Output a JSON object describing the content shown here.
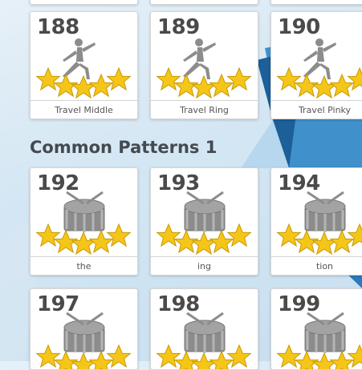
{
  "sections": [
    {
      "title": "",
      "lessons": [
        {
          "number": "188",
          "name": "Travel Middle",
          "icon": "yoga-pose-icon",
          "stars": 5
        },
        {
          "number": "189",
          "name": "Travel Ring",
          "icon": "yoga-pose-icon",
          "stars": 5
        },
        {
          "number": "190",
          "name": "Travel Pinky",
          "icon": "yoga-pose-icon",
          "stars": 5
        }
      ]
    },
    {
      "title": "Common Patterns 1",
      "lessons": [
        {
          "number": "192",
          "name": "the",
          "icon": "drum-icon",
          "stars": 5
        },
        {
          "number": "193",
          "name": "ing",
          "icon": "drum-icon",
          "stars": 5
        },
        {
          "number": "194",
          "name": "tion",
          "icon": "drum-icon",
          "stars": 5
        },
        {
          "number": "197",
          "name": "",
          "icon": "drum-icon",
          "stars": 5
        },
        {
          "number": "198",
          "name": "",
          "icon": "drum-icon",
          "stars": 5
        },
        {
          "number": "199",
          "name": "",
          "icon": "drum-icon",
          "stars": 5
        }
      ]
    }
  ],
  "colors": {
    "star": "#f5c518",
    "icon": "#8c8c8c",
    "accent_blue": "#1f6fb0"
  }
}
